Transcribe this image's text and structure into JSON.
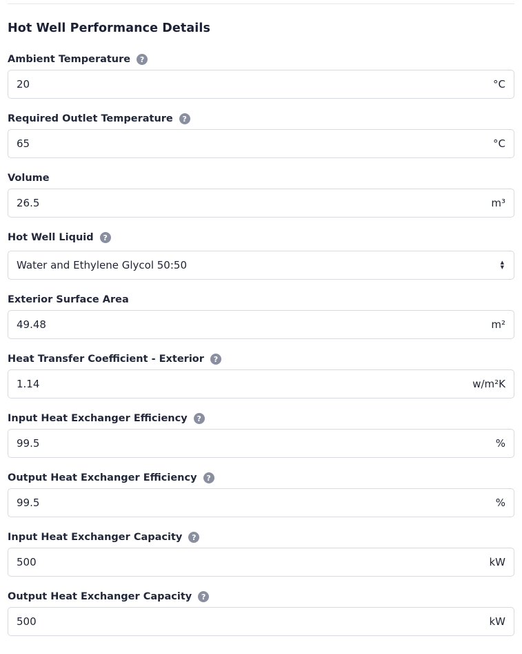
{
  "section": {
    "title": "Hot Well Performance Details"
  },
  "fields": {
    "ambient_temperature": {
      "label": "Ambient Temperature",
      "value": "20",
      "unit": "°C"
    },
    "required_outlet_temperature": {
      "label": "Required Outlet Temperature",
      "value": "65",
      "unit": "°C"
    },
    "volume": {
      "label": "Volume",
      "value": "26.5",
      "unit": "m³"
    },
    "hot_well_liquid": {
      "label": "Hot Well Liquid",
      "selected": "Water and Ethylene Glycol 50:50"
    },
    "exterior_surface_area": {
      "label": "Exterior Surface Area",
      "value": "49.48",
      "unit": "m²"
    },
    "heat_transfer_coefficient_exterior": {
      "label": "Heat Transfer Coefficient - Exterior",
      "value": "1.14",
      "unit": "w/m²K"
    },
    "input_hx_efficiency": {
      "label": "Input Heat Exchanger Efficiency",
      "value": "99.5",
      "unit": "%"
    },
    "output_hx_efficiency": {
      "label": "Output Heat Exchanger Efficiency",
      "value": "99.5",
      "unit": "%"
    },
    "input_hx_capacity": {
      "label": "Input Heat Exchanger Capacity",
      "value": "500",
      "unit": "kW"
    },
    "output_hx_capacity": {
      "label": "Output Heat Exchanger Capacity",
      "value": "500",
      "unit": "kW"
    }
  },
  "icons": {
    "help": "question-mark-circle",
    "select": "up-down-chevrons"
  },
  "help_glyph": "?",
  "colors": {
    "help_icon_bg": "#8a8fa0",
    "input_border": "#d6d9de",
    "heading_text": "#1b2035"
  }
}
